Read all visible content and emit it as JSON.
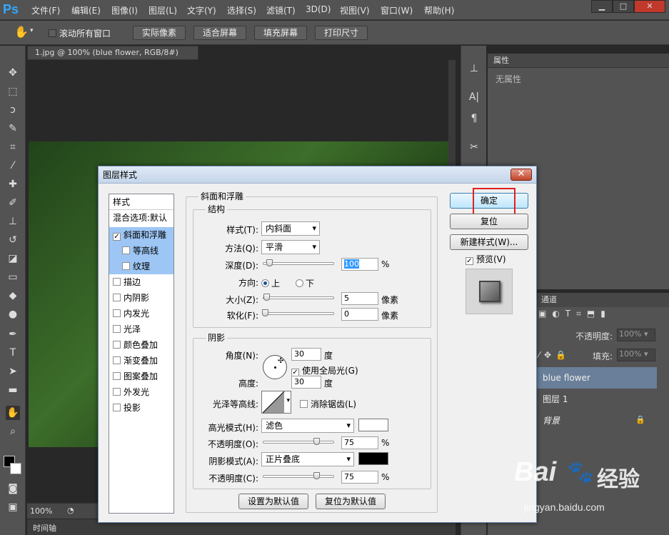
{
  "app": {
    "logo": "Ps"
  },
  "menu": [
    "文件(F)",
    "编辑(E)",
    "图像(I)",
    "图层(L)",
    "文字(Y)",
    "选择(S)",
    "滤镜(T)",
    "3D(D)",
    "视图(V)",
    "窗口(W)",
    "帮助(H)"
  ],
  "window_controls": {
    "minimize": "▁",
    "maximize": "□",
    "close": "✕"
  },
  "options": {
    "scroll_all": "滚动所有窗口",
    "buttons": [
      "实际像素",
      "适合屏幕",
      "填充屏幕",
      "打印尺寸"
    ]
  },
  "document": {
    "tab": "1.jpg @ 100% (blue flower, RGB/8#) *",
    "close": "×",
    "zoom": "100%",
    "timeline": "时间轴"
  },
  "properties": {
    "title": "属性",
    "empty": "无属性"
  },
  "layers": {
    "channels_tab": "通道",
    "opacity_label": "不透明度:",
    "opacity_value": "100%",
    "fill_label": "填充:",
    "fill_value": "100%",
    "items": [
      "blue flower",
      "图层 1",
      "背景"
    ]
  },
  "dialog": {
    "title": "图层样式",
    "close": "✕",
    "styles_header": "样式",
    "blend_default": "混合选项:默认",
    "style_items": [
      {
        "label": "斜面和浮雕",
        "checked": true,
        "selected": true
      },
      {
        "label": "等高线",
        "checked": false,
        "sub": true
      },
      {
        "label": "纹理",
        "checked": false,
        "sub": true
      },
      {
        "label": "描边",
        "checked": false
      },
      {
        "label": "内阴影",
        "checked": false
      },
      {
        "label": "内发光",
        "checked": false
      },
      {
        "label": "光泽",
        "checked": false
      },
      {
        "label": "颜色叠加",
        "checked": false
      },
      {
        "label": "渐变叠加",
        "checked": false
      },
      {
        "label": "图案叠加",
        "checked": false
      },
      {
        "label": "外发光",
        "checked": false
      },
      {
        "label": "投影",
        "checked": false
      }
    ],
    "bevel_title": "斜面和浮雕",
    "structure_title": "结构",
    "style_label": "样式(T):",
    "style_value": "内斜面",
    "technique_label": "方法(Q):",
    "technique_value": "平滑",
    "depth_label": "深度(D):",
    "depth_value": "100",
    "depth_unit": "%",
    "direction_label": "方向:",
    "direction_up": "上",
    "direction_down": "下",
    "size_label": "大小(Z):",
    "size_value": "5",
    "size_unit": "像素",
    "soften_label": "软化(F):",
    "soften_value": "0",
    "soften_unit": "像素",
    "shading_title": "阴影",
    "angle_label": "角度(N):",
    "angle_value": "30",
    "angle_unit": "度",
    "global_light": "使用全局光(G)",
    "altitude_label": "高度:",
    "altitude_value": "30",
    "altitude_unit": "度",
    "gloss_label": "光泽等高线:",
    "antialias": "消除锯齿(L)",
    "highlight_label": "高光模式(H):",
    "highlight_value": "滤色",
    "highlight_opacity_label": "不透明度(O):",
    "highlight_opacity_value": "75",
    "shadow_label": "阴影模式(A):",
    "shadow_value": "正片叠底",
    "shadow_opacity_label": "不透明度(C):",
    "shadow_opacity_value": "75",
    "percent": "%",
    "make_default": "设置为默认值",
    "reset_default": "复位为默认值",
    "ok": "确定",
    "reset": "复位",
    "new_style": "新建样式(W)...",
    "preview": "预览(V)",
    "colors": {
      "highlight": "#ffffff",
      "shadow": "#000000",
      "annotation": "#e02020"
    }
  },
  "watermark": {
    "brand": "Bai",
    "brand2": "经验",
    "url": "jingyan.baidu.com"
  }
}
